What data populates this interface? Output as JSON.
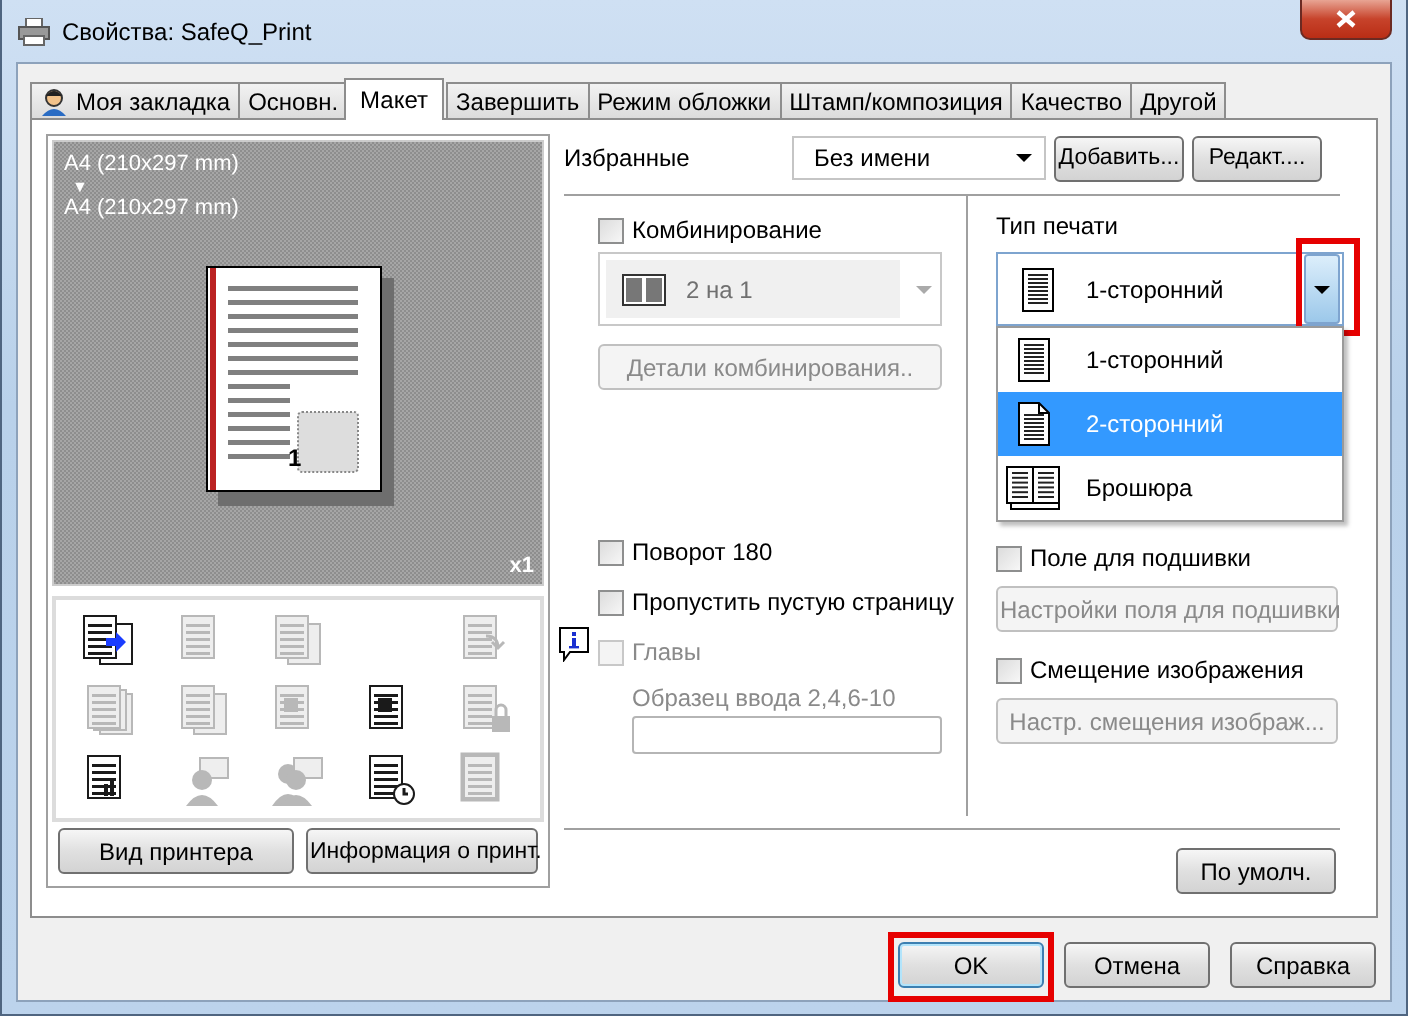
{
  "window": {
    "title": "Свойства: SafeQ_Print"
  },
  "tabs": [
    {
      "label": "Моя закладка",
      "kind": "icon",
      "selected": false
    },
    {
      "label": "Основн.",
      "kind": "text",
      "selected": false
    },
    {
      "label": "Макет",
      "kind": "text",
      "selected": true
    },
    {
      "label": "Завершить",
      "kind": "text",
      "selected": false
    },
    {
      "label": "Режим обложки",
      "kind": "text",
      "selected": false
    },
    {
      "label": "Штамп/композиция",
      "kind": "text",
      "selected": false
    },
    {
      "label": "Качество",
      "kind": "text",
      "selected": false
    },
    {
      "label": "Другой",
      "kind": "text",
      "selected": false
    }
  ],
  "preview": {
    "source_size": "A4 (210x297 mm)",
    "arrow": "▼",
    "output_size": "A4 (210x297 mm)",
    "page_number": "1",
    "copies": "x1"
  },
  "function_icons": [
    {
      "kind": "device",
      "disabled": false
    },
    {
      "kind": "poster",
      "disabled": true
    },
    {
      "kind": "copies",
      "disabled": true
    },
    {
      "kind": "empty"
    },
    {
      "kind": "swap",
      "disabled": true
    },
    {
      "kind": "stack",
      "disabled": true
    },
    {
      "kind": "combine",
      "disabled": true
    },
    {
      "kind": "overlay",
      "disabled": true
    },
    {
      "kind": "form",
      "disabled": false
    },
    {
      "kind": "lock",
      "disabled": true
    },
    {
      "kind": "report",
      "disabled": false
    },
    {
      "kind": "person",
      "disabled": true
    },
    {
      "kind": "people",
      "disabled": true
    },
    {
      "kind": "stamp",
      "disabled": false
    },
    {
      "kind": "frame",
      "disabled": true
    }
  ],
  "left_buttons": [
    "Вид принтера",
    "Информация о принт."
  ],
  "favorites": {
    "label": "Избранные",
    "value": "Без имени",
    "buttons": [
      "Добавить...",
      "Редакт...."
    ]
  },
  "combination": {
    "label": "Комбинирование",
    "checked": false,
    "value": "2 на 1",
    "disabled": true,
    "details_button": "Детали комбинирования.."
  },
  "print_type": {
    "label": "Тип печати",
    "value": "1-сторонний",
    "expanded": true,
    "highlighted": true,
    "options": [
      {
        "label": "1-сторонний",
        "kind": "simplex",
        "highlighted": false
      },
      {
        "label": "2-сторонний",
        "kind": "duplex",
        "highlighted": true
      },
      {
        "label": "Брошюра",
        "kind": "booklet",
        "highlighted": false
      }
    ]
  },
  "options_left": [
    {
      "label": "Поворот 180",
      "checked": false,
      "disabled": false,
      "info": false
    },
    {
      "label": "Пропустить пустую страницу",
      "checked": false,
      "disabled": false,
      "info": false
    },
    {
      "label": "Главы",
      "checked": false,
      "disabled": true,
      "info": true
    }
  ],
  "chapters": {
    "hint": "Образец ввода 2,4,6-10",
    "disabled": true
  },
  "options_right": [
    {
      "kind": "checkbox",
      "label": "Поле для подшивки",
      "checked": false,
      "disabled": false
    },
    {
      "kind": "button",
      "label": "Настройки поля для подшивки",
      "disabled": true
    },
    {
      "kind": "checkbox",
      "label": "Смещение изображения",
      "checked": false,
      "disabled": false
    },
    {
      "kind": "button",
      "label": "Настр. смещения изображ...",
      "disabled": true
    }
  ],
  "defaults_button": "По умолч.",
  "footer_buttons": [
    {
      "label": "OK",
      "highlighted": true
    },
    {
      "label": "Отмена",
      "highlighted": false
    },
    {
      "label": "Справка",
      "highlighted": false
    }
  ]
}
